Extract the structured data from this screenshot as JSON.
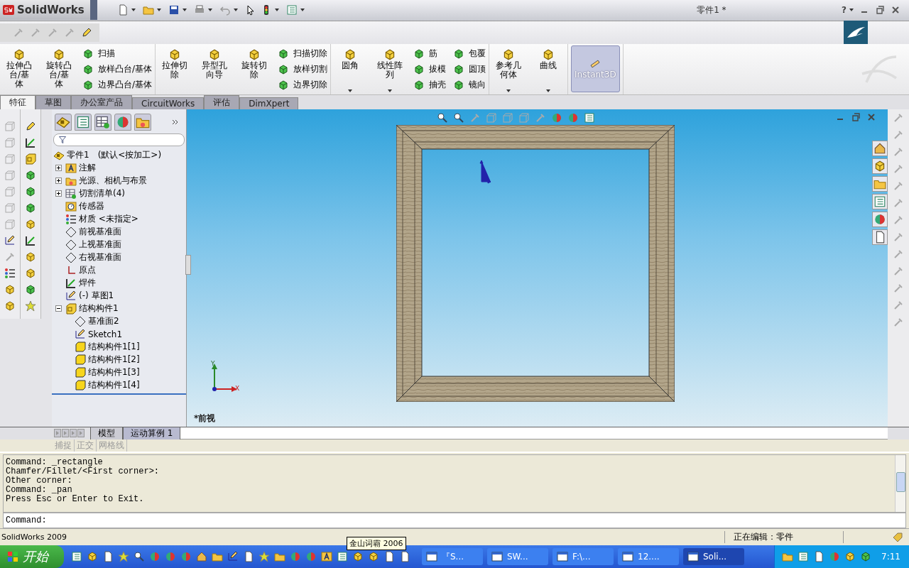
{
  "app": {
    "logo": "SolidWorks",
    "title": "零件1 *",
    "help": "?"
  },
  "ribbon": {
    "groups": [
      {
        "columns": [
          {
            "kind": "large",
            "label": "拉伸凸台/基体"
          },
          {
            "kind": "large",
            "label": "旋转凸台/基体"
          },
          {
            "kind": "stack",
            "items": [
              "扫描",
              "放样凸台/基体",
              "边界凸台/基体"
            ]
          }
        ]
      },
      {
        "columns": [
          {
            "kind": "large",
            "label": "拉伸切除"
          },
          {
            "kind": "large",
            "label": "异型孔向导"
          },
          {
            "kind": "large",
            "label": "旋转切除"
          },
          {
            "kind": "stack",
            "items": [
              "扫描切除",
              "放样切割",
              "边界切除"
            ]
          }
        ]
      },
      {
        "columns": [
          {
            "kind": "large",
            "label": "圆角",
            "dropdown": true
          },
          {
            "kind": "large",
            "label": "线性阵列",
            "dropdown": true
          },
          {
            "kind": "stack",
            "items": [
              "筋",
              "拔模",
              "抽壳"
            ]
          },
          {
            "kind": "stack",
            "items": [
              "包覆",
              "圆顶",
              "镜向"
            ]
          }
        ]
      },
      {
        "columns": [
          {
            "kind": "large",
            "label": "参考几何体",
            "dropdown": true
          },
          {
            "kind": "large",
            "label": "曲线",
            "dropdown": true
          }
        ]
      },
      {
        "columns": [
          {
            "kind": "toggle",
            "label": "Instant3D",
            "selected": true
          }
        ]
      }
    ]
  },
  "tabs": [
    {
      "label": "特征",
      "selected": true
    },
    {
      "label": "草图",
      "selected": false
    },
    {
      "label": "办公室产品",
      "selected": false
    },
    {
      "label": "CircuitWorks",
      "selected": false
    },
    {
      "label": "评估",
      "selected": false
    },
    {
      "label": "DimXpert",
      "selected": false
    }
  ],
  "tree": {
    "root": "零件1　(默认<按加工>)",
    "items": [
      {
        "kind": "annotation",
        "label": "注解",
        "expanded": false
      },
      {
        "kind": "lights",
        "label": "光源、相机与布景",
        "expanded": false
      },
      {
        "kind": "cutlist",
        "label": "切割清单(4)",
        "expanded": false
      },
      {
        "kind": "sensor",
        "label": "传感器"
      },
      {
        "kind": "material",
        "label": "材质 <未指定>"
      },
      {
        "kind": "plane",
        "label": "前视基准面"
      },
      {
        "kind": "plane",
        "label": "上视基准面"
      },
      {
        "kind": "plane",
        "label": "右视基准面"
      },
      {
        "kind": "origin",
        "label": "原点"
      },
      {
        "kind": "weldment",
        "label": "焊件"
      },
      {
        "kind": "sketch",
        "label": "(-) 草图1"
      },
      {
        "kind": "structure",
        "label": "结构构件1",
        "expanded": true,
        "children": [
          {
            "kind": "plane",
            "label": "基准面2"
          },
          {
            "kind": "sketch",
            "label": "Sketch1"
          },
          {
            "kind": "body",
            "label": "结构构件1[1]"
          },
          {
            "kind": "body",
            "label": "结构构件1[2]"
          },
          {
            "kind": "body",
            "label": "结构构件1[3]"
          },
          {
            "kind": "body",
            "label": "结构构件1[4]"
          }
        ]
      }
    ]
  },
  "view_label": "*前视",
  "triad": {
    "y": "Y",
    "x": "X"
  },
  "bottom_tabs": [
    {
      "label": "模型",
      "selected": false
    },
    {
      "label": "运动算例 1",
      "selected": true
    }
  ],
  "snap_bar": [
    "捕捉",
    "正交",
    "网格线"
  ],
  "command": {
    "lines": [
      "Command: _rectangle",
      "Chamfer/Fillet/<First corner>:",
      "Other corner:",
      "Command: _pan",
      "Press Esc or Enter to Exit."
    ],
    "prompt": "Command:"
  },
  "status_bar": {
    "left": "SolidWorks 2009",
    "right": "正在编辑：零件"
  },
  "taskbar": {
    "start": "开始",
    "tooltip": "金山词霸 2006",
    "tasks": [
      {
        "label": "『S...",
        "selected": false
      },
      {
        "label": "SW...",
        "selected": false
      },
      {
        "label": "F:\\...",
        "selected": false
      },
      {
        "label": "12....",
        "selected": false
      },
      {
        "label": "Soli...",
        "selected": true
      }
    ],
    "clock": "7:11"
  }
}
